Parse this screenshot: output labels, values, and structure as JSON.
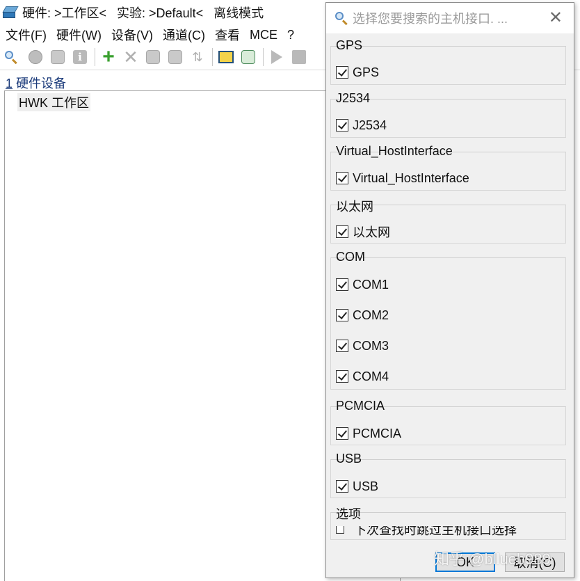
{
  "window": {
    "title": "硬件: >工作区<   实验: >Default<   离线模式"
  },
  "menubar": {
    "items": [
      "文件(F)",
      "硬件(W)",
      "设备(V)",
      "通道(C)",
      "查看",
      "MCE",
      "?"
    ]
  },
  "toolbar": {
    "icons": [
      "search-icon",
      "power-icon",
      "transfer-icon",
      "info-icon",
      "add-icon",
      "delete-icon",
      "package-icon",
      "chip-icon",
      "sort-icon",
      "monitor-icon",
      "network-icon",
      "play-icon",
      "stop-icon"
    ]
  },
  "hardware_panel": {
    "header_number": "1",
    "header_label": " 硬件设备",
    "tree_node": "HWK 工作区"
  },
  "dialog": {
    "search_placeholder": "选择您要搜索的主机接口. ...",
    "groups": [
      {
        "title": "GPS",
        "items": [
          {
            "label": "GPS",
            "checked": true
          }
        ]
      },
      {
        "title": "J2534",
        "items": [
          {
            "label": "J2534",
            "checked": true
          }
        ]
      },
      {
        "title": "Virtual_HostInterface",
        "items": [
          {
            "label": "Virtual_HostInterface",
            "checked": true
          }
        ]
      },
      {
        "title": "以太网",
        "items": [
          {
            "label": "以太网",
            "checked": true
          }
        ]
      },
      {
        "title": "COM",
        "items": [
          {
            "label": "COM1",
            "checked": true
          },
          {
            "label": "COM2",
            "checked": true
          },
          {
            "label": "COM3",
            "checked": true
          },
          {
            "label": "COM4",
            "checked": true
          }
        ]
      },
      {
        "title": "PCMCIA",
        "items": [
          {
            "label": "PCMCIA",
            "checked": true
          }
        ]
      },
      {
        "title": "USB",
        "items": [
          {
            "label": "USB",
            "checked": true
          }
        ]
      }
    ],
    "options_title": "选项",
    "options_item": "下次查找时跳过主机接口选择",
    "ok_label": "OK",
    "cancel_label": "取消(C)"
  },
  "watermark": "知乎 @bllueb989"
}
